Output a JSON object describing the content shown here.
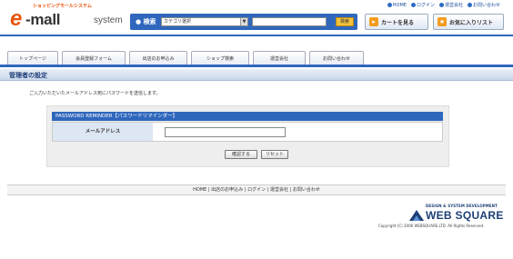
{
  "header": {
    "tagline": "ショッピングモールシステム",
    "logo_e": "e",
    "logo_mall": "-mall",
    "logo_system": "system",
    "topnav": [
      "HOME",
      "ログイン",
      "運営会社",
      "お問い合わせ"
    ],
    "search_label": "検索",
    "category_select": "カテゴリ選択",
    "search_button": "検索",
    "cart_button": "カートを見る",
    "favorites_button": "お気に入りリスト"
  },
  "tabs": [
    "トップページ",
    "会員登録フォーム",
    "出店のお申込み",
    "ショップ検索",
    "運営会社",
    "お問い合わせ"
  ],
  "page": {
    "title": "管理者の設定",
    "intro": "ご入力いただいたメールアドレス宛にパスワードを送信します。"
  },
  "form": {
    "heading": "PASSWORD REMINDER【パスワードリマインダー】",
    "email_label": "メールアドレス",
    "email_value": "",
    "confirm_button": "確認する",
    "reset_button": "リセット"
  },
  "footer": {
    "nav": [
      "HOME",
      "出店のお申込み",
      "ログイン",
      "運営会社",
      "お問い合わせ"
    ],
    "company_tag": "DESIGN & SYSTEM DEVELOPMENT",
    "company_name": "WEB SQUARE",
    "copyright": "Copyright (C) 2006 WEBSQUARE.LTD. All Rights Reserved."
  },
  "colors": {
    "accent": "#2f67bd",
    "brand": "#e8550c"
  }
}
